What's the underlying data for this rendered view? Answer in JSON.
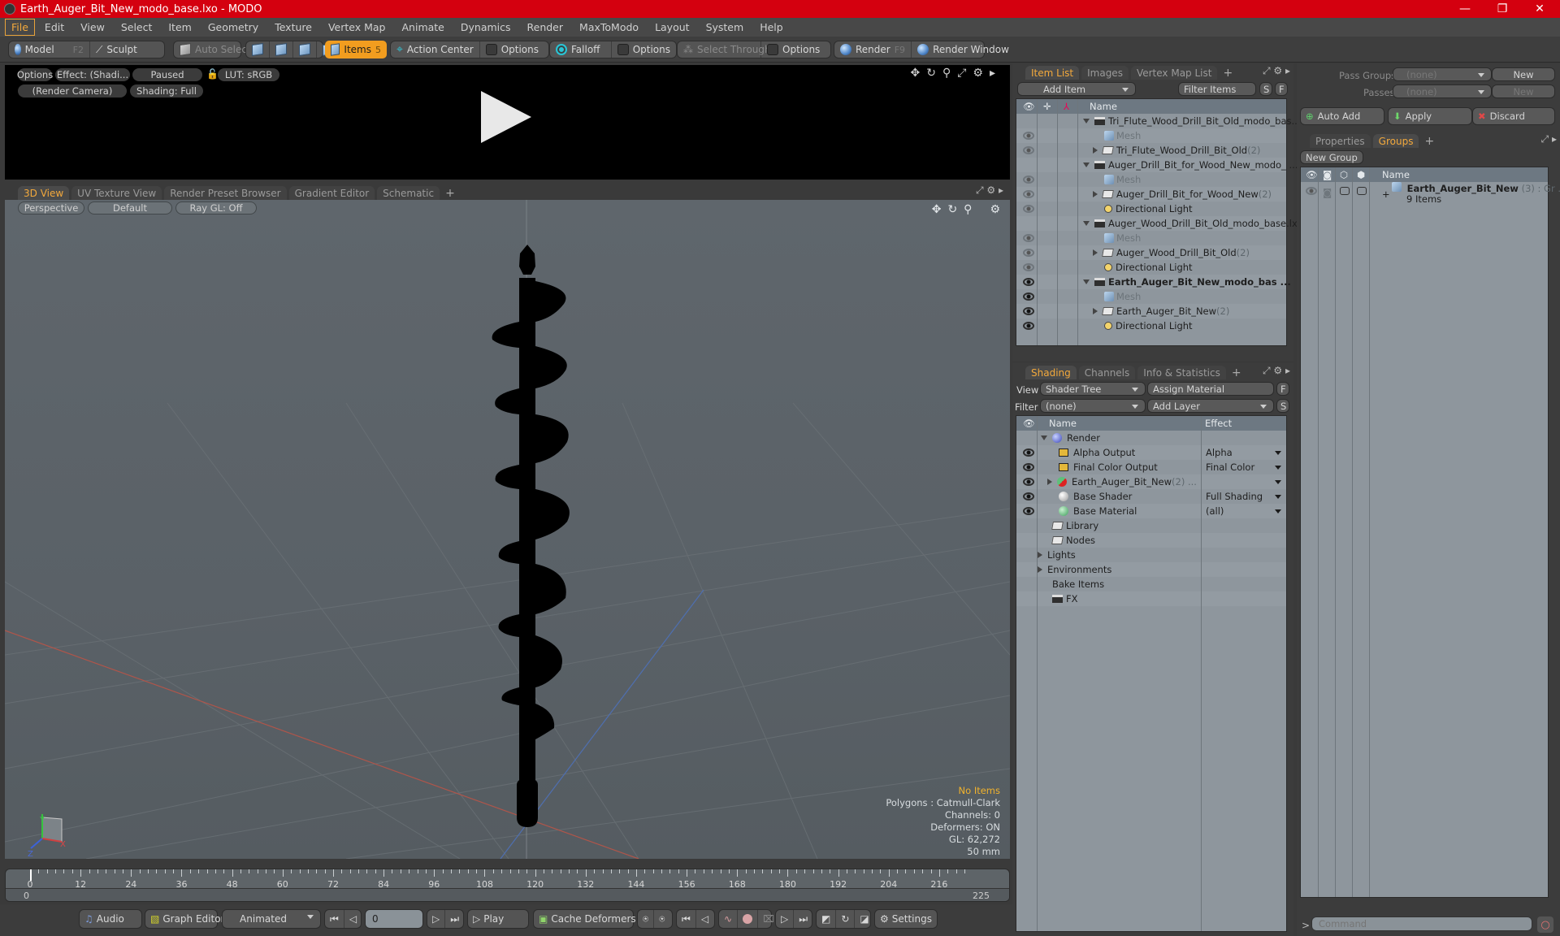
{
  "window": {
    "title": "Earth_Auger_Bit_New_modo_base.lxo - MODO",
    "controls": [
      "minimize",
      "restore",
      "close"
    ]
  },
  "menubar": [
    "File",
    "Edit",
    "View",
    "Select",
    "Item",
    "Geometry",
    "Texture",
    "Vertex Map",
    "Animate",
    "Dynamics",
    "Render",
    "MaxToModo",
    "Layout",
    "System",
    "Help"
  ],
  "toolbar": {
    "model": "Model",
    "model_key": "F2",
    "sculpt": "Sculpt",
    "auto_select": "Auto Select",
    "items": "Items",
    "items_key": "5",
    "action_center": "Action Center",
    "options1": "Options",
    "falloff": "Falloff",
    "options2": "Options",
    "select_through": "Select Through",
    "options3": "Options",
    "render": "Render",
    "render_key": "F9",
    "render_window": "Render Window"
  },
  "render_preview": {
    "options": "Options",
    "effect": "Effect: (Shadi...",
    "status": "Paused",
    "lut": "LUT: sRGB",
    "camera": "(Render Camera)",
    "shading": "Shading: Full"
  },
  "viewport_tabs": [
    "3D View",
    "UV Texture View",
    "Render Preset Browser",
    "Gradient Editor",
    "Schematic"
  ],
  "viewport": {
    "projection": "Perspective",
    "style": "Default",
    "raygl": "Ray GL: Off",
    "info": {
      "selection": "No Items",
      "polygons": "Polygons : Catmull-Clark",
      "channels": "Channels: 0",
      "deformers": "Deformers: ON",
      "gl": "GL: 62,272",
      "scale": "50 mm"
    },
    "axis_labels": {
      "x": "X",
      "y": "Y",
      "z": "Z"
    }
  },
  "timeline": {
    "ticks": [
      "0",
      "12",
      "24",
      "36",
      "48",
      "60",
      "72",
      "84",
      "96",
      "108",
      "120",
      "132",
      "144",
      "156",
      "168",
      "180",
      "192",
      "204",
      "216"
    ],
    "range_start": "0",
    "range_end": "225",
    "current_frame": 0
  },
  "transport": {
    "audio": "Audio",
    "graph_editor": "Graph Editor",
    "mode": "Animated",
    "frame": "0",
    "play": "Play",
    "cache_deformers": "Cache Deformers",
    "settings": "Settings"
  },
  "item_list": {
    "tabs": [
      "Item List",
      "Images",
      "Vertex Map List"
    ],
    "add_item": "Add Item",
    "filter": "Filter Items",
    "s_btn": "S",
    "f_btn": "F",
    "column_name": "Name",
    "rows": [
      {
        "label": "Tri_Flute_Wood_Drill_Bit_Old_modo_bas...",
        "type": "scene",
        "level": 0,
        "eye": "none",
        "bold": false
      },
      {
        "label": "Mesh",
        "type": "mesh",
        "level": 1,
        "eye": "dim",
        "bold": false
      },
      {
        "label": "Tri_Flute_Wood_Drill_Bit_Old",
        "count": "(2)",
        "type": "group",
        "level": 1,
        "eye": "dim",
        "bold": false
      },
      {
        "label": "Auger_Drill_Bit_for_Wood_New_modo_ ...",
        "type": "scene",
        "level": 0,
        "eye": "none",
        "bold": false
      },
      {
        "label": "Mesh",
        "type": "mesh",
        "level": 1,
        "eye": "dim",
        "bold": false
      },
      {
        "label": "Auger_Drill_Bit_for_Wood_New",
        "count": "(2)",
        "type": "group",
        "level": 1,
        "eye": "dim",
        "bold": false
      },
      {
        "label": "Directional Light",
        "type": "light",
        "level": 1,
        "eye": "dim",
        "bold": false
      },
      {
        "label": "Auger_Wood_Drill_Bit_Old_modo_base.lxo",
        "type": "scene",
        "level": 0,
        "eye": "none",
        "bold": false
      },
      {
        "label": "Mesh",
        "type": "mesh",
        "level": 1,
        "eye": "dim",
        "bold": false
      },
      {
        "label": "Auger_Wood_Drill_Bit_Old",
        "count": "(2)",
        "type": "group",
        "level": 1,
        "eye": "dim",
        "bold": false
      },
      {
        "label": "Directional Light",
        "type": "light",
        "level": 1,
        "eye": "dim",
        "bold": false
      },
      {
        "label": "Earth_Auger_Bit_New_modo_bas ...",
        "type": "scene",
        "level": 0,
        "eye": "on",
        "bold": true
      },
      {
        "label": "Mesh",
        "type": "mesh",
        "level": 1,
        "eye": "on",
        "bold": false
      },
      {
        "label": "Earth_Auger_Bit_New",
        "count": "(2)",
        "type": "group",
        "level": 1,
        "eye": "on",
        "bold": false
      },
      {
        "label": "Directional Light",
        "type": "light",
        "level": 1,
        "eye": "on",
        "bold": false
      }
    ]
  },
  "shading": {
    "tabs": [
      "Shading",
      "Channels",
      "Info & Statistics"
    ],
    "view_label": "View",
    "view_value": "Shader Tree",
    "assign_material": "Assign Material",
    "filter_label": "Filter",
    "filter_value": "(none)",
    "add_layer": "Add Layer",
    "f_btn": "F",
    "s_btn": "S",
    "col_name": "Name",
    "col_effect": "Effect",
    "rows": [
      {
        "label": "Render",
        "icon": "render-sphere",
        "level": 0,
        "eye": false,
        "effect": ""
      },
      {
        "label": "Alpha Output",
        "icon": "output",
        "level": 1,
        "eye": true,
        "effect": "Alpha"
      },
      {
        "label": "Final Color Output",
        "icon": "output",
        "level": 1,
        "eye": true,
        "effect": "Final Color"
      },
      {
        "label": "Earth_Auger_Bit_New",
        "count": "(2) ...",
        "icon": "material-group",
        "level": 1,
        "eye": true,
        "effect": ""
      },
      {
        "label": "Base Shader",
        "icon": "shader",
        "level": 1,
        "eye": true,
        "effect": "Full Shading"
      },
      {
        "label": "Base Material",
        "icon": "material",
        "level": 1,
        "eye": true,
        "effect": "(all)"
      },
      {
        "label": "Library",
        "icon": "folder",
        "level": 1,
        "eye": false,
        "effect": null
      },
      {
        "label": "Nodes",
        "icon": "folder",
        "level": 1,
        "eye": false,
        "effect": null
      },
      {
        "label": "Lights",
        "icon": "expand",
        "level": 0,
        "eye": false,
        "effect": null
      },
      {
        "label": "Environments",
        "icon": "expand",
        "level": 0,
        "eye": false,
        "effect": null
      },
      {
        "label": "Bake Items",
        "icon": "none",
        "level": 0,
        "eye": false,
        "effect": null
      },
      {
        "label": "FX",
        "icon": "clapper",
        "level": 1,
        "eye": false,
        "effect": null
      }
    ]
  },
  "pass_groups": {
    "pass_groups_label": "Pass Groups",
    "pass_groups_value": "(none)",
    "new1": "New",
    "passes_label": "Passes",
    "passes_value": "(none)",
    "new2": "New",
    "auto_add": "Auto Add",
    "apply": "Apply",
    "discard": "Discard"
  },
  "groups": {
    "tabs": [
      "Properties",
      "Groups"
    ],
    "new_group": "New Group",
    "col_name": "Name",
    "rows": [
      {
        "label": "Earth_Auger_Bit_New",
        "count": "(3)",
        "suffix": ": Gr ...",
        "sub": "9 Items"
      }
    ]
  },
  "command": {
    "prompt": ">",
    "placeholder": "Command"
  }
}
